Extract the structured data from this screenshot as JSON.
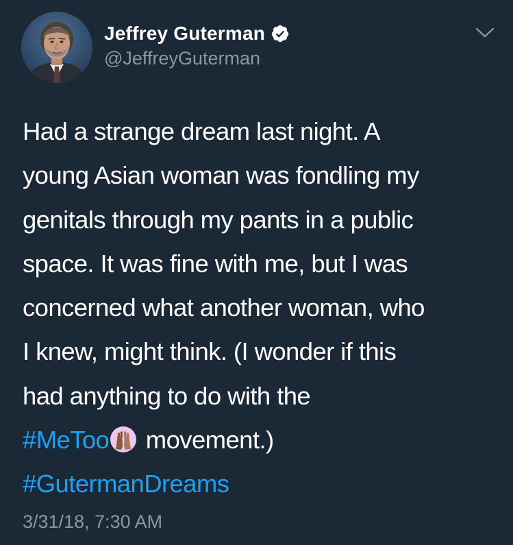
{
  "author": {
    "display_name": "Jeffrey Guterman",
    "handle": "@JeffreyGuterman",
    "verified": true
  },
  "icons": {
    "verified": "verified-badge-icon",
    "menu": "chevron-down-icon",
    "emoji": "raised-hands-emoji"
  },
  "tweet": {
    "lines": [
      "Had a strange dream last night. A",
      "young Asian woman was fondling my",
      "genitals through my pants in a public",
      "space. It was fine with me, but I was",
      "concerned what another woman, who",
      "I knew, might think. (I wonder if this",
      "had anything to do with the"
    ],
    "hashtag_metoo": "#MeToo",
    "after_emoji": " movement.)",
    "hashtag_dreams": "#GutermanDreams",
    "timestamp": "3/31/18, 7:30 AM"
  },
  "colors": {
    "background": "#1b2836",
    "text": "#ffffff",
    "secondary_text": "#8899a6",
    "link": "#1da1f2"
  }
}
